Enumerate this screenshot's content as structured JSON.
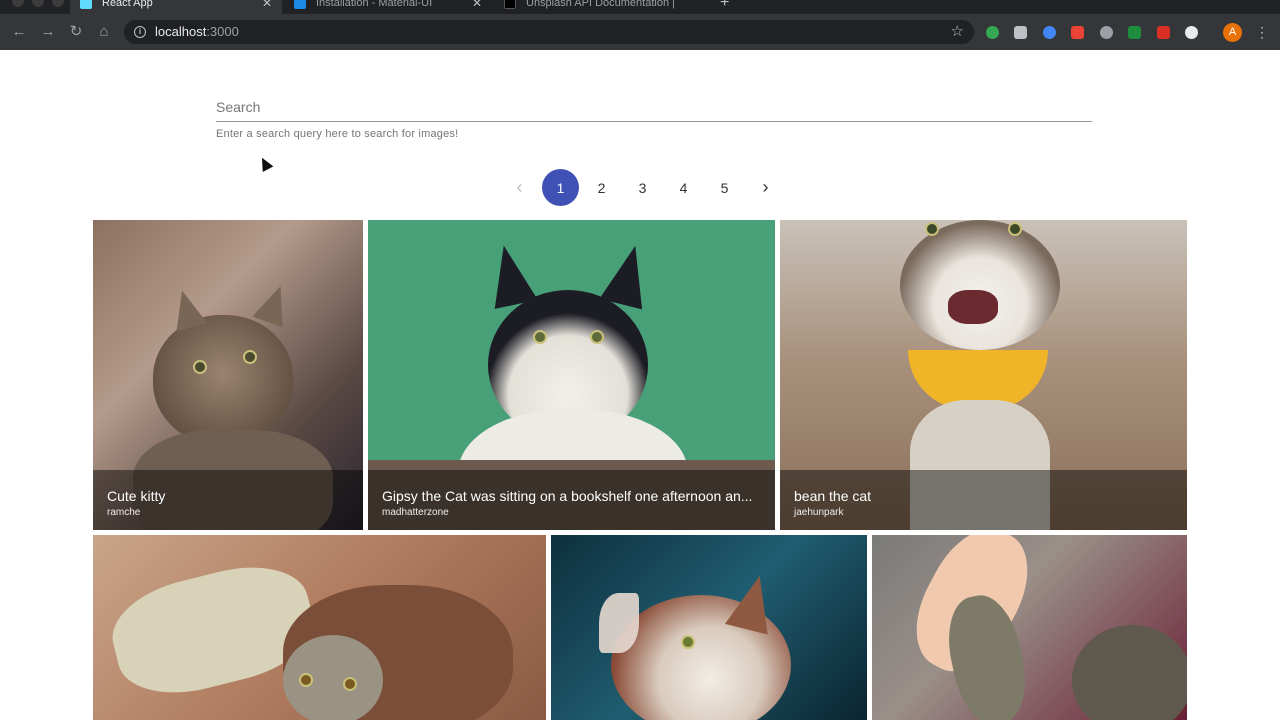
{
  "browser": {
    "tabs": [
      {
        "title": "React App",
        "favicon_color": "#61dafb",
        "active": true
      },
      {
        "title": "Installation - Material-UI",
        "favicon_color": "#1e88e5",
        "active": false
      },
      {
        "title": "Unsplash API Documentation |",
        "favicon_color": "#000000",
        "active": false
      }
    ],
    "tab_close": "✕",
    "new_tab": "+",
    "url_host": "localhost",
    "url_port": ":3000",
    "avatar_letter": "A",
    "icons": {
      "back": "←",
      "forward": "→",
      "reload": "↻",
      "home": "⌂",
      "star": "☆",
      "menu": "⋮",
      "info": "i"
    },
    "extensions": [
      "#34a853",
      "#bdc1c6",
      "#4285f4",
      "#ea4335",
      "#9aa0a6",
      "#1e8e3e",
      "#d93025",
      "#e8eaed"
    ]
  },
  "search": {
    "placeholder": "Search",
    "value": "",
    "helper": "Enter a search query here to search for images!"
  },
  "pagination": {
    "prev": "‹",
    "next": "›",
    "pages": [
      "1",
      "2",
      "3",
      "4",
      "5"
    ],
    "current": "1"
  },
  "images": [
    {
      "title": "Cute kitty",
      "author": "ramche"
    },
    {
      "title": "Gipsy the Cat was sitting on a bookshelf one afternoon an...",
      "author": "madhatterzone"
    },
    {
      "title": "bean the cat",
      "author": "jaehunpark"
    },
    {
      "title": "",
      "author": ""
    },
    {
      "title": "",
      "author": ""
    },
    {
      "title": "",
      "author": ""
    }
  ],
  "colors": {
    "accent": "#3f51b5"
  }
}
